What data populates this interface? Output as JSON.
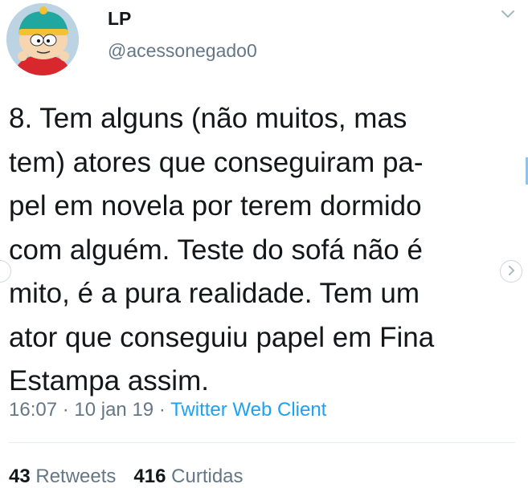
{
  "author": {
    "display_name": "LP",
    "handle": "@acessonegado0",
    "avatar_icon": "cartoon-avatar-icon"
  },
  "tweet": {
    "text": "8. Tem alguns (não muitos, mas\ntem) atores que conseguiram pa-\npel em novela por terem dormido\ncom alguém. Teste do sofá não é\nmito, é a pura realidade. Tem um\nator que conseguiu papel em Fina\nEstampa assim."
  },
  "meta": {
    "time": "16:07",
    "separator": " · ",
    "date": "10 jan 19",
    "client": "Twitter Web Client"
  },
  "stats": {
    "retweets_count": "43",
    "retweets_label": "Retweets",
    "likes_count": "416",
    "likes_label": "Curtidas"
  },
  "icons": {
    "menu": "chevron-down-icon",
    "next": "chevron-right-icon"
  },
  "colors": {
    "text": "#14171a",
    "secondary": "#657786",
    "link": "#1da1f2",
    "divider": "#e6ecf0"
  }
}
